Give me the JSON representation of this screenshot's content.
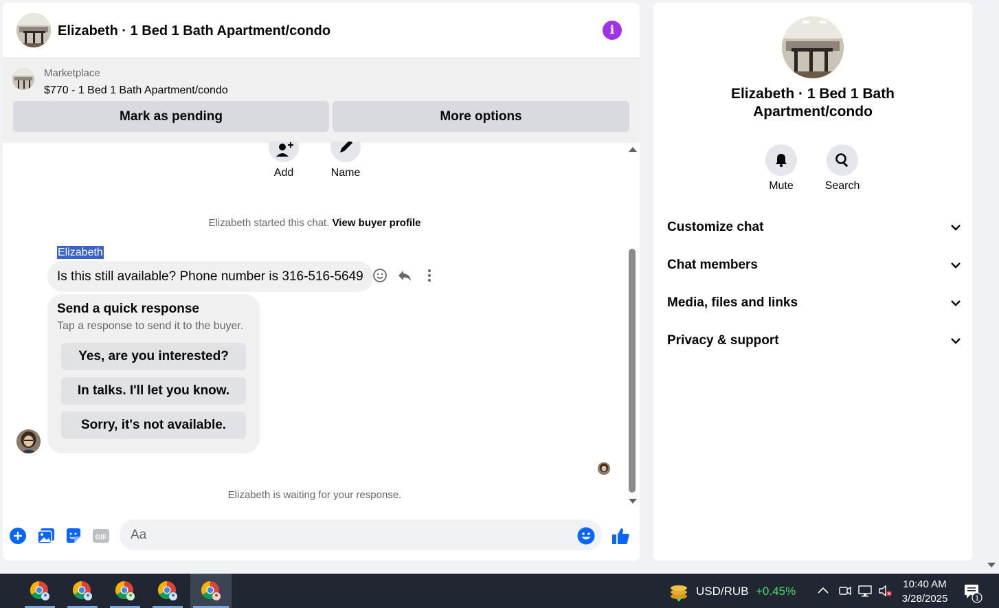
{
  "header": {
    "title": "Elizabeth · 1 Bed 1 Bath Apartment/condo",
    "info_glyph": "i"
  },
  "listing": {
    "source": "Marketplace",
    "name": "$770 - 1 Bed 1 Bath Apartment/condo",
    "buttons": {
      "pending": "Mark as pending",
      "more": "More options"
    }
  },
  "top_actions": {
    "add": "Add",
    "name": "Name"
  },
  "conversation": {
    "started_text": "Elizabeth started this chat.",
    "view_profile": "View buyer profile",
    "sender": "Elizabeth",
    "message": "Is this still available? Phone number is 316-516-5649",
    "quick": {
      "title": "Send a quick response",
      "subtitle": "Tap a response to send it to the buyer.",
      "options": [
        "Yes, are you interested?",
        "In talks. I'll let you know.",
        "Sorry, it's not available."
      ]
    },
    "waiting_text": "Elizabeth is waiting for your response."
  },
  "composer": {
    "placeholder": "Aa",
    "gif_label": "GIF"
  },
  "info_panel": {
    "title": "Elizabeth · 1 Bed 1 Bath Apartment/condo",
    "actions": {
      "mute": "Mute",
      "search": "Search"
    },
    "sections": [
      "Customize chat",
      "Chat members",
      "Media, files and links",
      "Privacy & support"
    ]
  },
  "taskbar": {
    "ticker_name": "USD/RUB",
    "ticker_change": "+0.45%",
    "time": "10:40 AM",
    "date": "3/28/2025",
    "notification_count": "1"
  },
  "colors": {
    "accent": "#0866ff",
    "info": "#a033e8",
    "taskbar": "#202733",
    "positive": "#4cd964"
  }
}
